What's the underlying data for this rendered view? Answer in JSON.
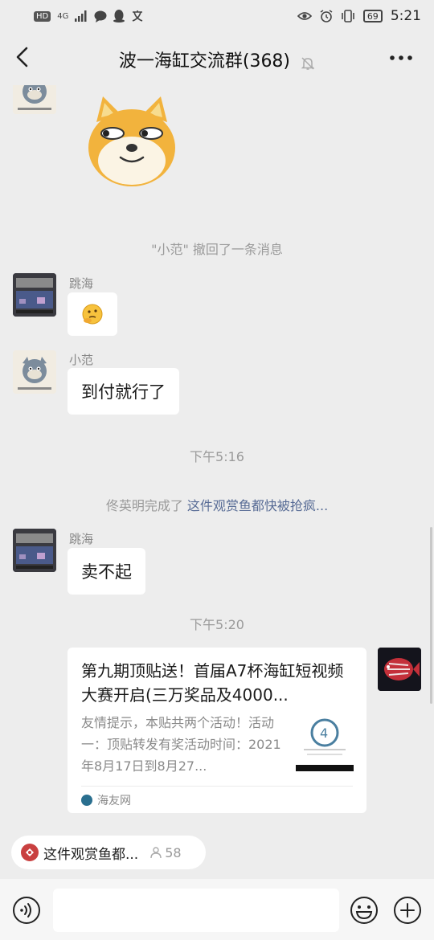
{
  "status_bar": {
    "left_badge": "HD",
    "network": "4G",
    "time": "5:21",
    "battery": "69"
  },
  "header": {
    "title": "波一海缸交流群(368)"
  },
  "messages": {
    "recall_notice": "\"小范\" 撤回了一条消息",
    "msg1_sender": "跳海",
    "msg2_sender": "小范",
    "msg2_text": "到付就行了",
    "time1": "下午5:16",
    "pin_notice_prefix": "佟英明完成了 ",
    "pin_notice_link": "这件观赏鱼都快被抢疯...",
    "msg3_sender": "跳海",
    "msg3_text": "卖不起",
    "time2": "下午5:20"
  },
  "card": {
    "title": "第九期顶贴送！首届A7杯海缸短视频大赛开启(三万奖品及4000...",
    "description": "友情提示，本贴共两个活动！活动一：顶贴转发有奖活动时间：2021年8月17日到8月27...",
    "source": "海友网"
  },
  "pinned": {
    "text": "这件观赏鱼都...",
    "count": "58"
  },
  "input": {
    "placeholder": ""
  },
  "colors": {
    "link": "#576b95",
    "background": "#ededed"
  }
}
